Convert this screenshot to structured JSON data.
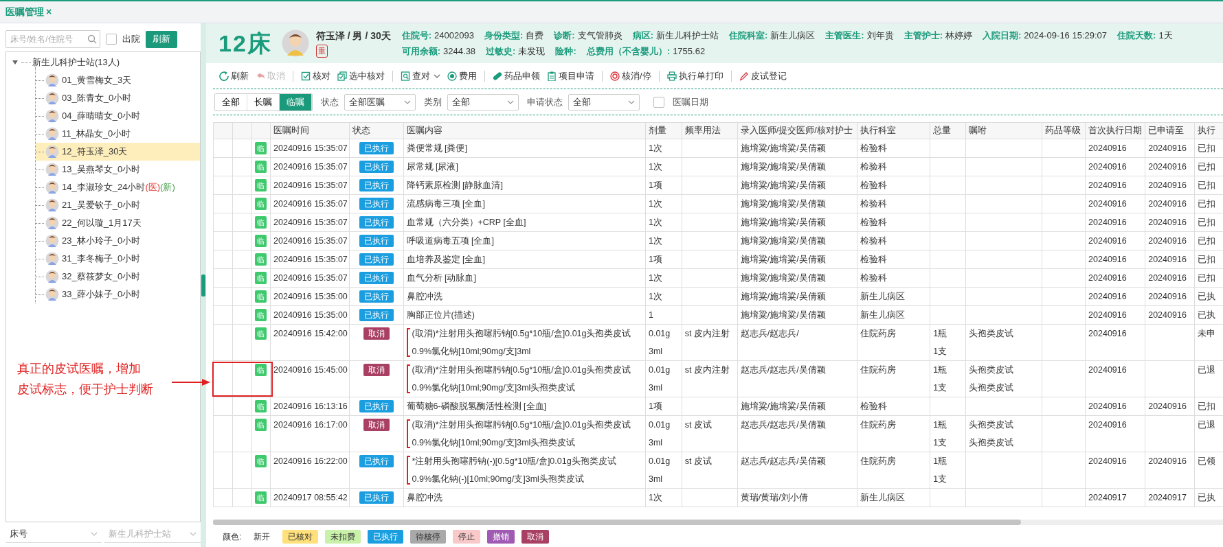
{
  "tab": {
    "title": "医嘱管理",
    "close": "×"
  },
  "sidebar": {
    "search": {
      "placeholder": "床号/姓名/住院号"
    },
    "discharged": {
      "label": "出院",
      "checked": false
    },
    "refresh": "刷新",
    "tree": {
      "label": "新生儿科护士站(13人)",
      "expanded": true,
      "children": [
        {
          "label": "01_黄雪梅女_3天",
          "selected": false
        },
        {
          "label": "03_陈青女_0小时",
          "selected": false
        },
        {
          "label": "04_薛晴晴女_0小时",
          "selected": false
        },
        {
          "label": "11_林晶女_0小时",
          "selected": false
        },
        {
          "label": "12_符玉泽_30天",
          "selected": true
        },
        {
          "label": "13_吴燕琴女_0小时",
          "selected": false
        },
        {
          "label": "14_李淑珍女_24小时",
          "selected": false,
          "tags": [
            {
              "text": "(医)",
              "color": "#e53935"
            },
            {
              "text": "(新)",
              "color": "#43a047"
            }
          ]
        },
        {
          "label": "21_吴爱钦子_0小时",
          "selected": false
        },
        {
          "label": "22_何以璇_1月17天",
          "selected": false
        },
        {
          "label": "23_林小玲子_0小时",
          "selected": false
        },
        {
          "label": "31_李冬梅子_0小时",
          "selected": false
        },
        {
          "label": "32_蔡筱梦女_0小时",
          "selected": false
        },
        {
          "label": "33_薛小妹子_0小时",
          "selected": false
        }
      ]
    },
    "footer": [
      {
        "value": "床号",
        "disabled": false
      },
      {
        "value": "新生儿科护士站",
        "disabled": true
      }
    ]
  },
  "patient": {
    "bed": "12床",
    "name": "符玉泽 / 男 / 30天",
    "flag": "重",
    "fields": [
      [
        {
          "label": "住院号:",
          "value": "24002093"
        },
        {
          "label": "身份类型:",
          "value": "自费"
        },
        {
          "label": "诊断:",
          "value": "支气管肺炎"
        },
        {
          "label": "病区:",
          "value": "新生儿科护士站"
        },
        {
          "label": "住院科室:",
          "value": "新生儿病区"
        },
        {
          "label": "主管医生:",
          "value": "刘年贵"
        },
        {
          "label": "主管护士:",
          "value": "林婷婷"
        },
        {
          "label": "入院日期:",
          "value": "2024-09-16 15:29:07"
        },
        {
          "label": "住院天数:",
          "value": "1天"
        }
      ],
      [
        {
          "label": "可用余额:",
          "value": "3244.38"
        },
        {
          "label": "过敏史:",
          "value": "未发现"
        },
        {
          "label": "险种:"
        },
        {
          "label": "总费用（不含婴儿）:",
          "value": "1755.62"
        }
      ]
    ]
  },
  "toolbar": [
    [
      {
        "label": "刷新",
        "disabled": false
      },
      {
        "label": "取消",
        "disabled": true
      }
    ],
    [
      {
        "label": "核对",
        "disabled": false
      },
      {
        "label": "选中核对",
        "disabled": false
      }
    ],
    [
      {
        "label": "查对",
        "disabled": false,
        "dropdown": true
      },
      {
        "label": "费用",
        "disabled": false
      }
    ],
    [
      {
        "label": "药品申领",
        "disabled": false
      },
      {
        "label": "项目申请",
        "disabled": false
      }
    ],
    [
      {
        "label": "核消/停",
        "disabled": false
      }
    ],
    [
      {
        "label": "执行单打印",
        "disabled": false
      }
    ],
    [
      {
        "label": "皮试登记",
        "disabled": false
      }
    ]
  ],
  "filter": {
    "segments": [
      {
        "label": "全部",
        "selected": false
      },
      {
        "label": "长嘱",
        "selected": false
      },
      {
        "label": "临嘱",
        "selected": true
      }
    ],
    "selects": [
      {
        "label": "状态",
        "value": "全部医嘱"
      },
      {
        "label": "类别",
        "value": "全部"
      },
      {
        "label": "申请状态",
        "value": "全部"
      }
    ],
    "date_check": {
      "label": "医嘱日期",
      "checked": false
    }
  },
  "table": {
    "columns": [
      "医嘱时间",
      "状态",
      "医嘱内容",
      "剂量",
      "频率用法",
      "录入医师/提交医师/核对护士",
      "执行科室",
      "总量",
      "嘱咐",
      "药品等级",
      "首次执行日期",
      "已申请至",
      "执行"
    ],
    "rows": [
      {
        "tag": "临",
        "time": "20240916 15:35:07",
        "status": {
          "text": "已执行",
          "kind": "done"
        },
        "content": [
          "粪便常规 [粪便]"
        ],
        "grouped": false,
        "dose": [
          "1次"
        ],
        "freq": "",
        "doctors": "施堉粱/施堉粱/吴倩颖",
        "dept": "检验科",
        "total": [],
        "note": [],
        "first": "20240916",
        "applied": "20240916",
        "exec": "已扣"
      },
      {
        "tag": "临",
        "time": "20240916 15:35:07",
        "status": {
          "text": "已执行",
          "kind": "done"
        },
        "content": [
          "尿常规 [尿液]"
        ],
        "grouped": false,
        "dose": [
          "1次"
        ],
        "freq": "",
        "doctors": "施堉粱/施堉粱/吴倩颖",
        "dept": "检验科",
        "total": [],
        "note": [],
        "first": "20240916",
        "applied": "20240916",
        "exec": "已扣"
      },
      {
        "tag": "临",
        "time": "20240916 15:35:07",
        "status": {
          "text": "已执行",
          "kind": "done"
        },
        "content": [
          "降钙素原检测 [静脉血清]"
        ],
        "grouped": false,
        "dose": [
          "1项"
        ],
        "freq": "",
        "doctors": "施堉粱/施堉粱/吴倩颖",
        "dept": "检验科",
        "total": [],
        "note": [],
        "first": "20240916",
        "applied": "20240916",
        "exec": "已扣"
      },
      {
        "tag": "临",
        "time": "20240916 15:35:07",
        "status": {
          "text": "已执行",
          "kind": "done"
        },
        "content": [
          "流感病毒三项 [全血]"
        ],
        "grouped": false,
        "dose": [
          "1次"
        ],
        "freq": "",
        "doctors": "施堉粱/施堉粱/吴倩颖",
        "dept": "检验科",
        "total": [],
        "note": [],
        "first": "20240916",
        "applied": "20240916",
        "exec": "已扣"
      },
      {
        "tag": "临",
        "time": "20240916 15:35:07",
        "status": {
          "text": "已执行",
          "kind": "done"
        },
        "content": [
          "血常规（六分类）+CRP [全血]"
        ],
        "grouped": false,
        "dose": [
          "1次"
        ],
        "freq": "",
        "doctors": "施堉粱/施堉粱/吴倩颖",
        "dept": "检验科",
        "total": [],
        "note": [],
        "first": "20240916",
        "applied": "20240916",
        "exec": "已扣"
      },
      {
        "tag": "临",
        "time": "20240916 15:35:07",
        "status": {
          "text": "已执行",
          "kind": "done"
        },
        "content": [
          "呼吸道病毒五项 [全血]"
        ],
        "grouped": false,
        "dose": [
          "1次"
        ],
        "freq": "",
        "doctors": "施堉粱/施堉粱/吴倩颖",
        "dept": "检验科",
        "total": [],
        "note": [],
        "first": "20240916",
        "applied": "20240916",
        "exec": "已扣"
      },
      {
        "tag": "临",
        "time": "20240916 15:35:07",
        "status": {
          "text": "已执行",
          "kind": "done"
        },
        "content": [
          "血培养及鉴定 [全血]"
        ],
        "grouped": false,
        "dose": [
          "1项"
        ],
        "freq": "",
        "doctors": "施堉粱/施堉粱/吴倩颖",
        "dept": "检验科",
        "total": [],
        "note": [],
        "first": "20240916",
        "applied": "20240916",
        "exec": "已扣"
      },
      {
        "tag": "临",
        "time": "20240916 15:35:07",
        "status": {
          "text": "已执行",
          "kind": "done"
        },
        "content": [
          "血气分析 [动脉血]"
        ],
        "grouped": false,
        "dose": [
          "1次"
        ],
        "freq": "",
        "doctors": "施堉粱/施堉粱/吴倩颖",
        "dept": "检验科",
        "total": [],
        "note": [],
        "first": "20240916",
        "applied": "20240916",
        "exec": "已扣"
      },
      {
        "tag": "临",
        "time": "20240916 15:35:00",
        "status": {
          "text": "已执行",
          "kind": "done"
        },
        "content": [
          "鼻腔冲洗"
        ],
        "grouped": false,
        "dose": [
          "1次"
        ],
        "freq": "",
        "doctors": "施堉粱/施堉粱/吴倩颖",
        "dept": "新生儿病区",
        "total": [],
        "note": [],
        "first": "20240916",
        "applied": "20240916",
        "exec": "已执"
      },
      {
        "tag": "临",
        "time": "20240916 15:35:00",
        "status": {
          "text": "已执行",
          "kind": "done"
        },
        "content": [
          "胸部正位片(描述)"
        ],
        "grouped": false,
        "dose": [
          "1"
        ],
        "freq": "",
        "doctors": "施堉粱/施堉粱/吴倩颖",
        "dept": "新生儿病区",
        "total": [],
        "note": [],
        "first": "20240916",
        "applied": "20240916",
        "exec": "已执"
      },
      {
        "tag": "临",
        "time": "20240916 15:42:00",
        "status": {
          "text": "取消",
          "kind": "cancelled"
        },
        "content": [
          "(取消)*注射用头孢噻肟钠[0.5g*10瓶/盒]0.01g头孢类皮试",
          "0.9%氯化钠[10ml;90mg/支]3ml"
        ],
        "grouped": true,
        "dose": [
          "0.01g",
          "3ml"
        ],
        "freq": "st 皮内注射",
        "doctors": "赵志兵/赵志兵/",
        "dept": "住院药房",
        "total": [
          "1瓶",
          "1支"
        ],
        "note": [
          "头孢类皮试"
        ],
        "first": "20240916",
        "applied": "",
        "exec": "未申"
      },
      {
        "tag": "临",
        "time": "20240916 15:45:00",
        "status": {
          "text": "取消",
          "kind": "cancelled"
        },
        "content": [
          "(取消)*注射用头孢噻肟钠[0.5g*10瓶/盒]0.01g头孢类皮试",
          "0.9%氯化钠[10ml;90mg/支]3ml头孢类皮试"
        ],
        "grouped": true,
        "dose": [
          "0.01g",
          "3ml"
        ],
        "freq": "st 皮内注射",
        "doctors": "赵志兵/赵志兵/吴倩颖",
        "dept": "住院药房",
        "total": [
          "1瓶",
          "1支"
        ],
        "note": [
          "头孢类皮试",
          "头孢类皮试"
        ],
        "first": "20240916",
        "applied": "",
        "exec": "已退"
      },
      {
        "tag": "临",
        "time": "20240916 16:13:16",
        "status": {
          "text": "已执行",
          "kind": "done"
        },
        "content": [
          "葡萄糖6-磷酸脱氢酶活性检测 [全血]"
        ],
        "grouped": false,
        "dose": [
          "1项"
        ],
        "freq": "",
        "doctors": "施堉粱/施堉粱/吴倩颖",
        "dept": "检验科",
        "total": [],
        "note": [],
        "first": "20240916",
        "applied": "20240916",
        "exec": "已扣"
      },
      {
        "tag": "临",
        "time": "20240916 16:17:00",
        "status": {
          "text": "取消",
          "kind": "cancelled"
        },
        "content": [
          "(取消)*注射用头孢噻肟钠[0.5g*10瓶/盒]0.01g头孢类皮试",
          "0.9%氯化钠[10ml;90mg/支]3ml头孢类皮试"
        ],
        "grouped": true,
        "dose": [
          "0.01g",
          "3ml"
        ],
        "freq": "st 皮试",
        "doctors": "赵志兵/赵志兵/吴倩颖",
        "dept": "住院药房",
        "total": [
          "1瓶",
          "1支"
        ],
        "note": [
          "头孢类皮试",
          "头孢类皮试"
        ],
        "first": "20240916",
        "applied": "",
        "exec": "已退"
      },
      {
        "tag": "临",
        "time": "20240916 16:22:00",
        "status": {
          "text": "已执行",
          "kind": "done"
        },
        "content": [
          "*注射用头孢噻肟钠(-)[0.5g*10瓶/盒]0.01g头孢类皮试",
          "0.9%氯化钠(-)[10ml;90mg/支]3ml头孢类皮试"
        ],
        "grouped": true,
        "dose": [
          "0.01g",
          "3ml"
        ],
        "freq": "st 皮试",
        "doctors": "赵志兵/赵志兵/吴倩颖",
        "dept": "住院药房",
        "total": [
          "1瓶",
          "1支"
        ],
        "note": [],
        "first": "20240916",
        "applied": "20240916",
        "exec": "已领"
      },
      {
        "tag": "临",
        "time": "20240917 08:55:42",
        "status": {
          "text": "已执行",
          "kind": "done"
        },
        "content": [
          "鼻腔冲洗"
        ],
        "grouped": false,
        "dose": [
          "1次"
        ],
        "freq": "",
        "doctors": "黄瑞/黄瑞/刘小倩",
        "dept": "新生儿病区",
        "total": [],
        "note": [],
        "first": "20240917",
        "applied": "20240917",
        "exec": "已执"
      }
    ]
  },
  "legend": {
    "label": "颜色:",
    "items": [
      {
        "text": "新开"
      },
      {
        "text": "已核对",
        "color": "#ffe07a"
      },
      {
        "text": "未扣费",
        "color": "#c9f1a9"
      },
      {
        "text": "已执行",
        "color": "#1a9ee0"
      },
      {
        "text": "待核停",
        "color": "#a9a9a9"
      },
      {
        "text": "停止",
        "color": "#f9c9c9"
      },
      {
        "text": "撤销",
        "color": "#a05ab4"
      },
      {
        "text": "取消",
        "color": "#a94064"
      }
    ]
  },
  "annotation": {
    "lines": [
      "真正的皮试医嘱，增加",
      "皮试标志，便于护士判断"
    ]
  }
}
